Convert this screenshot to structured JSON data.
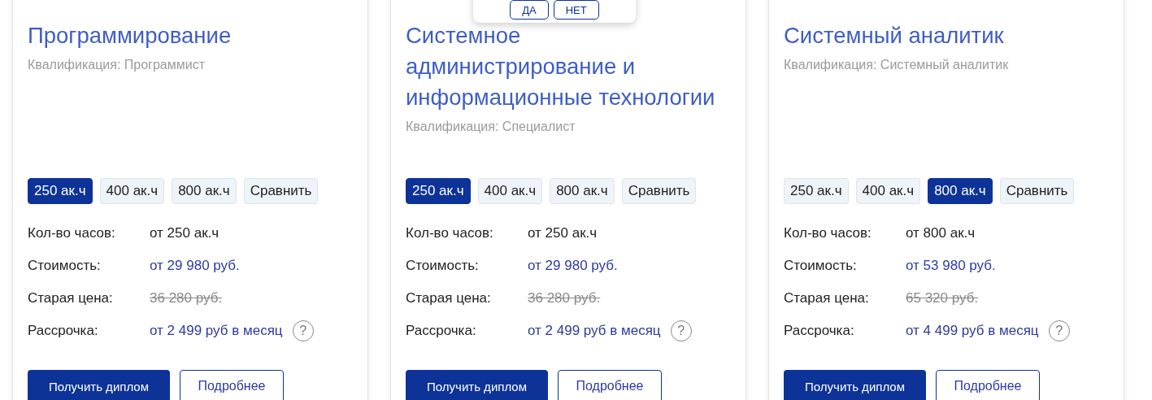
{
  "popup": {
    "buttons": [
      "ДА",
      "НЕТ"
    ]
  },
  "cards": [
    {
      "title": "Программирование",
      "qualification": "Квалификация: Программист",
      "options": [
        {
          "label": "250 ак.ч",
          "selected": true
        },
        {
          "label": "400 ак.ч",
          "selected": false
        },
        {
          "label": "800 ак.ч",
          "selected": false
        }
      ],
      "compare": "Сравнить",
      "rows": [
        {
          "kind": "plain",
          "label": "Кол-во часов:",
          "value": "от 250 ак.ч"
        },
        {
          "kind": "price",
          "label": "Стоимость:",
          "value": "от 29 980 руб."
        },
        {
          "kind": "old_price",
          "label": "Старая цена:",
          "value": "36 280 руб."
        },
        {
          "kind": "installment",
          "label": "Рассрочка:",
          "value": "от 2 499 руб в месяц",
          "help": "?"
        }
      ],
      "primary": "Получить диплом",
      "secondary": "Подробнее"
    },
    {
      "title": "Системное администрирование и информационные технологии",
      "qualification": "Квалификация: Специалист",
      "options": [
        {
          "label": "250 ак.ч",
          "selected": true
        },
        {
          "label": "400 ак.ч",
          "selected": false
        },
        {
          "label": "800 ак.ч",
          "selected": false
        }
      ],
      "compare": "Сравнить",
      "rows": [
        {
          "kind": "plain",
          "label": "Кол-во часов:",
          "value": "от 250 ак.ч"
        },
        {
          "kind": "price",
          "label": "Стоимость:",
          "value": "от 29 980 руб."
        },
        {
          "kind": "old_price",
          "label": "Старая цена:",
          "value": "36 280 руб."
        },
        {
          "kind": "installment",
          "label": "Рассрочка:",
          "value": "от 2 499 руб в месяц",
          "help": "?"
        }
      ],
      "primary": "Получить диплом",
      "secondary": "Подробнее"
    },
    {
      "title": "Системный аналитик",
      "qualification": "Квалификация: Системный аналитик",
      "options": [
        {
          "label": "250 ак.ч",
          "selected": false
        },
        {
          "label": "400 ак.ч",
          "selected": false
        },
        {
          "label": "800 ак.ч",
          "selected": true
        }
      ],
      "compare": "Сравнить",
      "rows": [
        {
          "kind": "plain",
          "label": "Кол-во часов:",
          "value": "от 800 ак.ч"
        },
        {
          "kind": "price",
          "label": "Стоимость:",
          "value": "от 53 980 руб."
        },
        {
          "kind": "old_price",
          "label": "Старая цена:",
          "value": "65 320 руб."
        },
        {
          "kind": "installment",
          "label": "Рассрочка:",
          "value": "от 4 499 руб в месяц",
          "help": "?"
        }
      ],
      "primary": "Получить диплом",
      "secondary": "Подробнее"
    }
  ]
}
